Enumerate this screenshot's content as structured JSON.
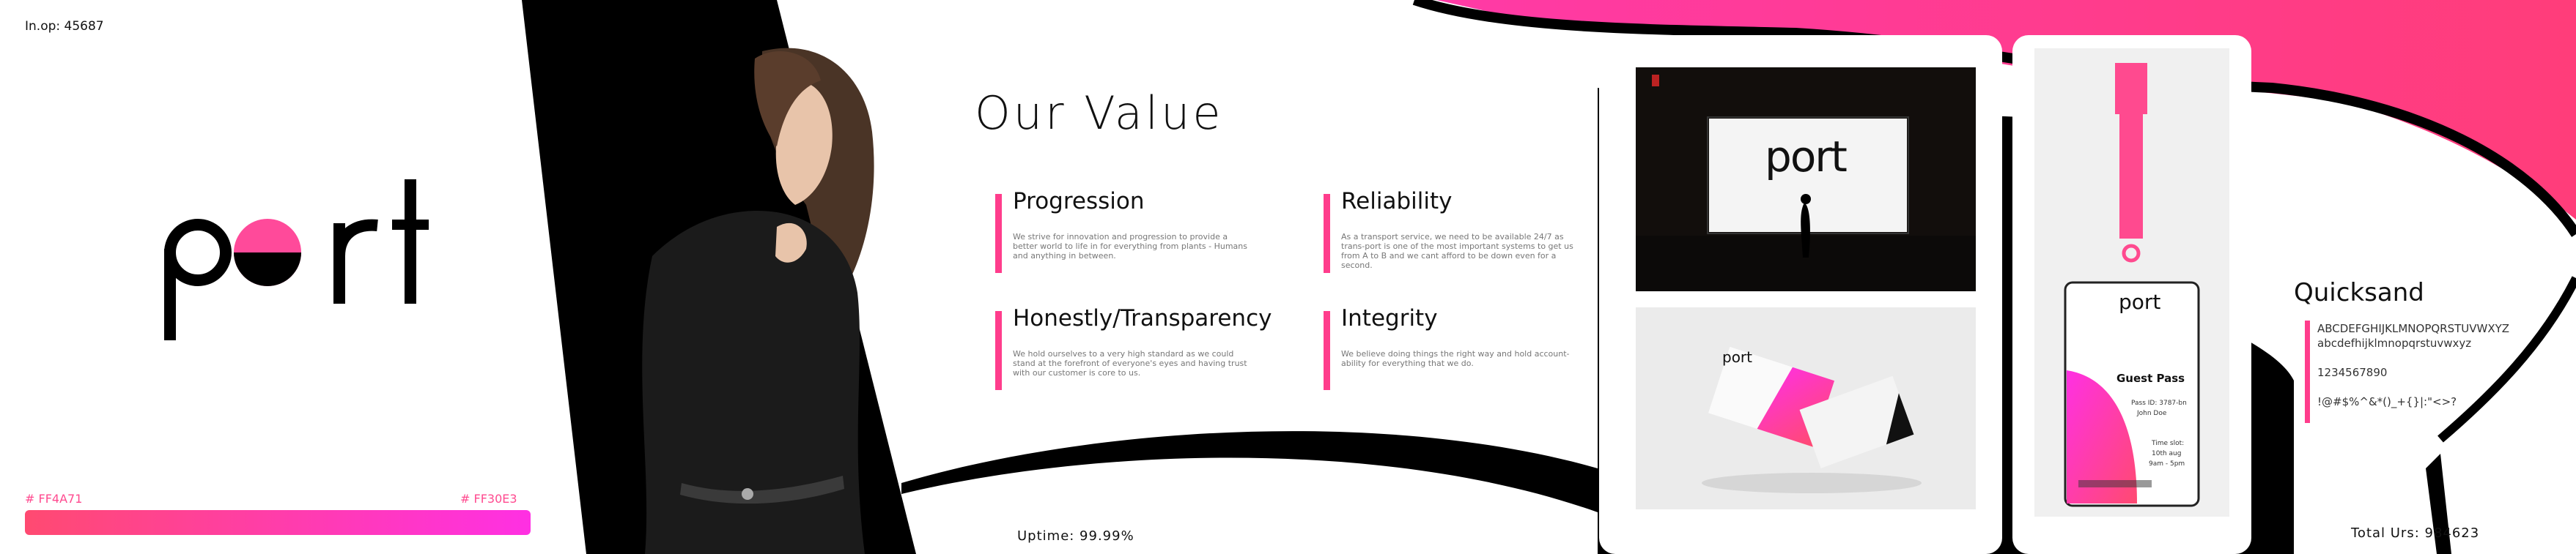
{
  "left_panel": {
    "inop": "In.op: 45687",
    "logo_text": "port",
    "swatch_left": "# FF4A71",
    "swatch_right": "# FF30E3"
  },
  "values": {
    "title": "Our Value",
    "items": [
      {
        "heading": "Progression",
        "text": "We strive for innovation and progression to provide a better world to life in for everything from plants - Humans and anything in between."
      },
      {
        "heading": "Reliability",
        "text": "As a transport service, we need to be available 24/7 as trans-port is one of the most important systems to get us from A to B and we cant afford to be down even for a second."
      },
      {
        "heading": "Honestly/Transparency",
        "text": "We hold ourselves to a very high standard as we could stand at the forefront of everyone's eyes and having trust with our customer is core to us."
      },
      {
        "heading": "Integrity",
        "text": "We believe doing things the right way and hold account-ability for everything that we do."
      }
    ],
    "uptime": "Uptime: 99.99%"
  },
  "mockups": {
    "billboard_logo": "port",
    "card_logo": "port",
    "badge_logo": "port",
    "badge_title": "Guest Pass",
    "badge_pass_id": "Pass ID: 3787-bn",
    "badge_name": "John Doe",
    "badge_time_label": "Time slot:",
    "badge_date": "10th aug",
    "badge_time": "9am - 5pm"
  },
  "typography": {
    "font_name": "Quicksand",
    "uppercase": "ABCDEFGHIJKLMNOPQRSTUVWXYZ",
    "lowercase": "abcdefhijklmnopqrstuvwxyz",
    "digits": "1234567890",
    "symbols": "!@#$%^&*()_+{}|:\"<>?",
    "total": "Total Urs: 984623"
  },
  "colors": {
    "accent_pink": "#FF4A71",
    "accent_magenta": "#FF30E3"
  }
}
